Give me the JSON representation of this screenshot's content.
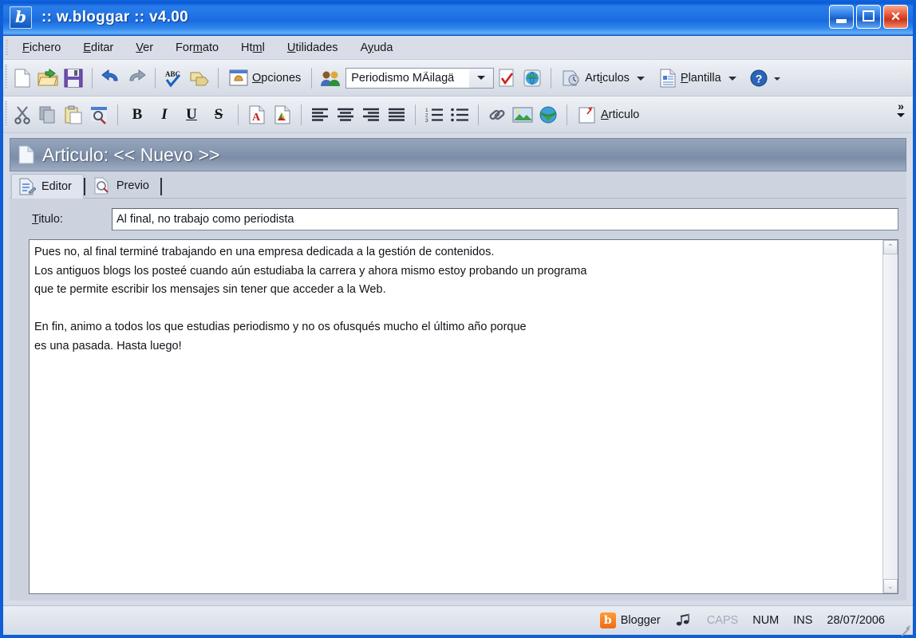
{
  "window": {
    "title": ":: w.bloggar :: v4.00",
    "app_icon": "b",
    "buttons": {
      "minimize": "minimize-button",
      "maximize": "maximize-button",
      "close": "×"
    }
  },
  "menubar": {
    "items": [
      {
        "label": "Fichero",
        "accel": "F"
      },
      {
        "label": "Editar",
        "accel": "E"
      },
      {
        "label": "Ver",
        "accel": "V"
      },
      {
        "label": "Formato",
        "accel": "m"
      },
      {
        "label": "Html",
        "accel": "m"
      },
      {
        "label": "Utilidades",
        "accel": "U"
      },
      {
        "label": "Ayuda",
        "accel": "y"
      }
    ]
  },
  "toolbar_top": {
    "new_label": "",
    "open_label": "",
    "save_label": "",
    "undo_label": "",
    "redo_label": "",
    "spell_label": "",
    "tags_label": "",
    "options_label": "Opciones",
    "blog_combo_value": "Periodismo MÃilagä",
    "post_check_label": "",
    "publish_label": "",
    "articles_label": "Articulos",
    "template_label": "Plantilla",
    "help_label": ""
  },
  "toolbar_format": {
    "cut_label": "",
    "copy_label": "",
    "paste_label": "",
    "find_label": "",
    "bold_label": "B",
    "italic_label": "I",
    "underline_label": "U",
    "strike_label": "S",
    "font_color_label": "A",
    "back_color_label": "A",
    "align_left_label": "",
    "align_center_label": "",
    "align_right_label": "",
    "align_justify_label": "",
    "ordered_list_label": "",
    "unordered_list_label": "",
    "link_label": "",
    "image_label": "",
    "upload_label": "",
    "post_label": "Articulo",
    "overflow_label": "»"
  },
  "section": {
    "title": "Articulo: << Nuevo >>"
  },
  "tabs": [
    {
      "label": "Editor",
      "active": true
    },
    {
      "label": "Previo",
      "active": false
    }
  ],
  "editor": {
    "title_label": "Titulo:",
    "title_value": "Al final, no trabajo como periodista",
    "title_placeholder": "",
    "body_value": "Pues no, al final terminé trabajando en una empresa dedicada a la gestión de contenidos.\nLos antiguos blogs los posteé cuando aún estudiaba la carrera y ahora mismo estoy probando un programa\nque te permite escribir los mensajes sin tener que acceder a la Web.\n\nEn fin, animo a todos los que estudias periodismo y no os ofusqués mucho el último año porque\nes una pasada. Hasta luego!",
    "scroll_up": "⌃",
    "scroll_down": "⌄"
  },
  "statusbar": {
    "service": "Blogger",
    "sound_icon": "music-note-icon",
    "caps": "CAPS",
    "num": "NUM",
    "ins": "INS",
    "date": "28/07/2006"
  },
  "colors": {
    "titlebar_blue": "#1a6ade",
    "window_bg": "#d6dce8",
    "section_header": "#8496af",
    "accent_orange": "#f06a12"
  }
}
